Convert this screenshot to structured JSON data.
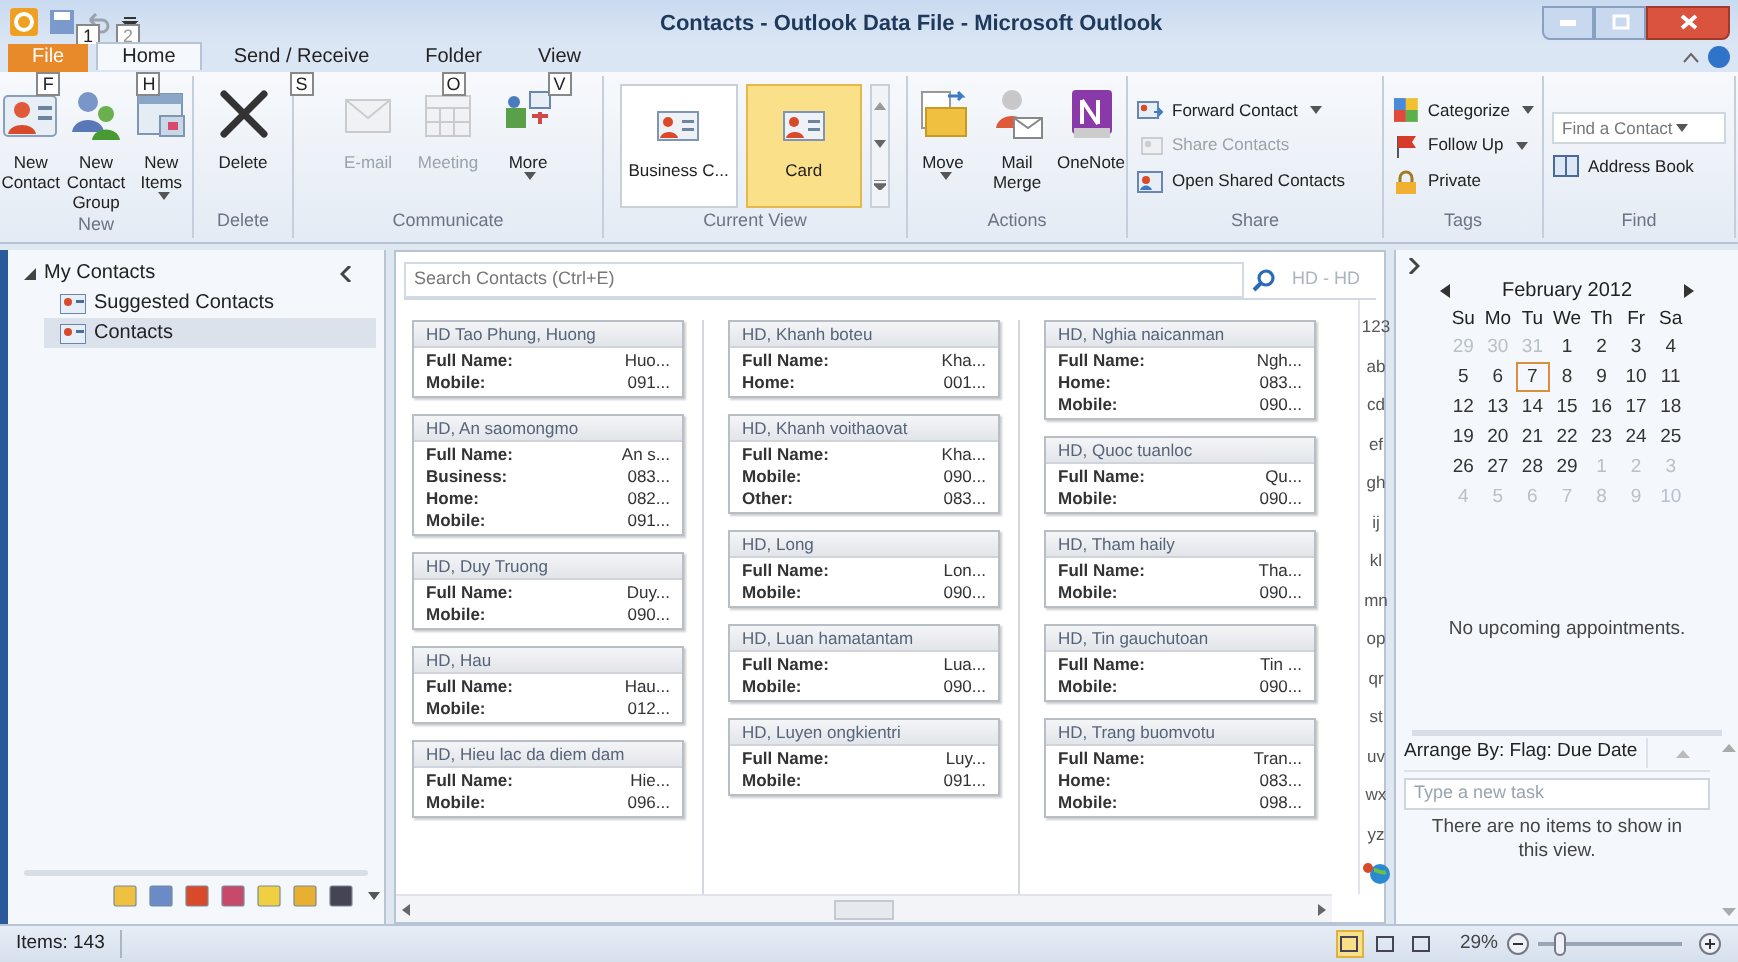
{
  "window": {
    "title": "Contacts - Outlook Data File - Microsoft Outlook"
  },
  "quick_access_keytips": [
    "1",
    "2"
  ],
  "tabs": [
    {
      "label": "File",
      "selected": false,
      "kind": "file",
      "keytip": "F"
    },
    {
      "label": "Home",
      "selected": true,
      "kind": "tab",
      "keytip": "H"
    },
    {
      "label": "Send / Receive",
      "selected": false,
      "kind": "tab",
      "keytip": "S"
    },
    {
      "label": "Folder",
      "selected": false,
      "kind": "tab",
      "keytip": "O"
    },
    {
      "label": "View",
      "selected": false,
      "kind": "tab",
      "keytip": "V"
    }
  ],
  "ribbon": [
    {
      "label": "New",
      "items": [
        {
          "label": "New Contact",
          "kind": "large",
          "disabled": false
        },
        {
          "label": "New Contact Group",
          "kind": "large",
          "disabled": false
        },
        {
          "label": "New Items",
          "kind": "large",
          "disabled": false,
          "dropdown": true
        }
      ]
    },
    {
      "label": "Delete",
      "items": [
        {
          "label": "Delete",
          "kind": "large",
          "disabled": false
        }
      ]
    },
    {
      "label": "Communicate",
      "items": [
        {
          "label": "E-mail",
          "kind": "large",
          "disabled": true
        },
        {
          "label": "Meeting",
          "kind": "large",
          "disabled": true
        },
        {
          "label": "More",
          "kind": "large",
          "disabled": false,
          "dropdown": true
        }
      ]
    },
    {
      "label": "Current View",
      "items": [
        {
          "label": "Business C...",
          "kind": "gallery",
          "selected": false
        },
        {
          "label": "Card",
          "kind": "gallery",
          "selected": true
        }
      ]
    },
    {
      "label": "Actions",
      "items": [
        {
          "label": "Move",
          "kind": "large",
          "disabled": false,
          "dropdown": true
        },
        {
          "label": "Mail Merge",
          "kind": "large",
          "disabled": false
        },
        {
          "label": "OneNote",
          "kind": "large",
          "disabled": false
        }
      ]
    },
    {
      "label": "Share",
      "items": [
        {
          "label": "Forward Contact",
          "kind": "small",
          "disabled": false,
          "dropdown": true
        },
        {
          "label": "Share Contacts",
          "kind": "small",
          "disabled": true
        },
        {
          "label": "Open Shared Contacts",
          "kind": "small",
          "disabled": false
        }
      ]
    },
    {
      "label": "Tags",
      "items": [
        {
          "label": "Categorize",
          "kind": "small",
          "disabled": false,
          "dropdown": true
        },
        {
          "label": "Follow Up",
          "kind": "small",
          "disabled": false,
          "dropdown": true
        },
        {
          "label": "Private",
          "kind": "small",
          "disabled": false
        }
      ]
    },
    {
      "label": "Find",
      "items": [
        {
          "label": "Find a Contact",
          "kind": "search",
          "disabled": false,
          "dropdown": true
        },
        {
          "label": "Address Book",
          "kind": "small",
          "disabled": false
        }
      ]
    }
  ],
  "navigation": {
    "label": "My Contacts",
    "expanded": true,
    "children": [
      {
        "label": "Suggested Contacts",
        "selected": false
      },
      {
        "label": "Contacts",
        "selected": true
      }
    ]
  },
  "search": {
    "placeholder": "Search Contacts (Ctrl+E)",
    "scope": "HD - HD"
  },
  "card_columns": [
    [
      {
        "title": "HD Tao Phung, Huong",
        "fields": [
          {
            "label": "Full Name:",
            "value": "Huo..."
          },
          {
            "label": "Mobile:",
            "value": "091..."
          }
        ]
      },
      {
        "title": "HD, An saomongmo",
        "fields": [
          {
            "label": "Full Name:",
            "value": "An s..."
          },
          {
            "label": "Business:",
            "value": "083..."
          },
          {
            "label": "Home:",
            "value": "082..."
          },
          {
            "label": "Mobile:",
            "value": "091..."
          }
        ]
      },
      {
        "title": "HD, Duy Truong",
        "fields": [
          {
            "label": "Full Name:",
            "value": "Duy..."
          },
          {
            "label": "Mobile:",
            "value": "090..."
          }
        ]
      },
      {
        "title": "HD, Hau",
        "fields": [
          {
            "label": "Full Name:",
            "value": "Hau..."
          },
          {
            "label": "Mobile:",
            "value": "012..."
          }
        ]
      },
      {
        "title": "HD, Hieu lac da diem dam",
        "fields": [
          {
            "label": "Full Name:",
            "value": "Hie..."
          },
          {
            "label": "Mobile:",
            "value": "096..."
          }
        ]
      }
    ],
    [
      {
        "title": "HD, Khanh boteu",
        "fields": [
          {
            "label": "Full Name:",
            "value": "Kha..."
          },
          {
            "label": "Home:",
            "value": "001..."
          }
        ]
      },
      {
        "title": "HD, Khanh voithaovat",
        "fields": [
          {
            "label": "Full Name:",
            "value": "Kha..."
          },
          {
            "label": "Mobile:",
            "value": "090..."
          },
          {
            "label": "Other:",
            "value": "083..."
          }
        ]
      },
      {
        "title": "HD, Long",
        "fields": [
          {
            "label": "Full Name:",
            "value": "Lon..."
          },
          {
            "label": "Mobile:",
            "value": "090..."
          }
        ]
      },
      {
        "title": "HD, Luan hamatantam",
        "fields": [
          {
            "label": "Full Name:",
            "value": "Lua..."
          },
          {
            "label": "Mobile:",
            "value": "090..."
          }
        ]
      },
      {
        "title": "HD, Luyen ongkientri",
        "fields": [
          {
            "label": "Full Name:",
            "value": "Luy..."
          },
          {
            "label": "Mobile:",
            "value": "091..."
          }
        ]
      }
    ],
    [
      {
        "title": "HD, Nghia naicanman",
        "fields": [
          {
            "label": "Full Name:",
            "value": "Ngh..."
          },
          {
            "label": "Home:",
            "value": "083..."
          },
          {
            "label": "Mobile:",
            "value": "090..."
          }
        ]
      },
      {
        "title": "HD, Quoc tuanloc",
        "fields": [
          {
            "label": "Full Name:",
            "value": "Qu..."
          },
          {
            "label": "Mobile:",
            "value": "090..."
          }
        ]
      },
      {
        "title": "HD, Tham haily",
        "fields": [
          {
            "label": "Full Name:",
            "value": "Tha..."
          },
          {
            "label": "Mobile:",
            "value": "090..."
          }
        ]
      },
      {
        "title": "HD, Tin gauchutoan",
        "fields": [
          {
            "label": "Full Name:",
            "value": "Tin ..."
          },
          {
            "label": "Mobile:",
            "value": "090..."
          }
        ]
      },
      {
        "title": "HD, Trang buomvotu",
        "fields": [
          {
            "label": "Full Name:",
            "value": "Tran..."
          },
          {
            "label": "Home:",
            "value": "083..."
          },
          {
            "label": "Mobile:",
            "value": "098..."
          }
        ]
      }
    ]
  ],
  "index": [
    "123",
    "ab",
    "cd",
    "ef",
    "gh",
    "ij",
    "kl",
    "mn",
    "op",
    "qr",
    "st",
    "uv",
    "wx",
    "yz"
  ],
  "calendar": {
    "month": "February 2012",
    "weekdays": [
      "Su",
      "Mo",
      "Tu",
      "We",
      "Th",
      "Fr",
      "Sa"
    ],
    "weeks": [
      [
        {
          "day": "29",
          "other_month": true,
          "selected": false
        },
        {
          "day": "30",
          "other_month": true,
          "selected": false
        },
        {
          "day": "31",
          "other_month": true,
          "selected": false
        },
        {
          "day": "1",
          "other_month": false,
          "selected": false
        },
        {
          "day": "2",
          "other_month": false,
          "selected": false
        },
        {
          "day": "3",
          "other_month": false,
          "selected": false
        },
        {
          "day": "4",
          "other_month": false,
          "selected": false
        }
      ],
      [
        {
          "day": "5",
          "other_month": false,
          "selected": false
        },
        {
          "day": "6",
          "other_month": false,
          "selected": false
        },
        {
          "day": "7",
          "other_month": false,
          "selected": true
        },
        {
          "day": "8",
          "other_month": false,
          "selected": false
        },
        {
          "day": "9",
          "other_month": false,
          "selected": false
        },
        {
          "day": "10",
          "other_month": false,
          "selected": false
        },
        {
          "day": "11",
          "other_month": false,
          "selected": false
        }
      ],
      [
        {
          "day": "12",
          "other_month": false,
          "selected": false
        },
        {
          "day": "13",
          "other_month": false,
          "selected": false
        },
        {
          "day": "14",
          "other_month": false,
          "selected": false
        },
        {
          "day": "15",
          "other_month": false,
          "selected": false
        },
        {
          "day": "16",
          "other_month": false,
          "selected": false
        },
        {
          "day": "17",
          "other_month": false,
          "selected": false
        },
        {
          "day": "18",
          "other_month": false,
          "selected": false
        }
      ],
      [
        {
          "day": "19",
          "other_month": false,
          "selected": false
        },
        {
          "day": "20",
          "other_month": false,
          "selected": false
        },
        {
          "day": "21",
          "other_month": false,
          "selected": false
        },
        {
          "day": "22",
          "other_month": false,
          "selected": false
        },
        {
          "day": "23",
          "other_month": false,
          "selected": false
        },
        {
          "day": "24",
          "other_month": false,
          "selected": false
        },
        {
          "day": "25",
          "other_month": false,
          "selected": false
        }
      ],
      [
        {
          "day": "26",
          "other_month": false,
          "selected": false
        },
        {
          "day": "27",
          "other_month": false,
          "selected": false
        },
        {
          "day": "28",
          "other_month": false,
          "selected": false
        },
        {
          "day": "29",
          "other_month": false,
          "selected": false
        },
        {
          "day": "1",
          "other_month": true,
          "selected": false
        },
        {
          "day": "2",
          "other_month": true,
          "selected": false
        },
        {
          "day": "3",
          "other_month": true,
          "selected": false
        }
      ],
      [
        {
          "day": "4",
          "other_month": true,
          "selected": false
        },
        {
          "day": "5",
          "other_month": true,
          "selected": false
        },
        {
          "day": "6",
          "other_month": true,
          "selected": false
        },
        {
          "day": "7",
          "other_month": true,
          "selected": false
        },
        {
          "day": "8",
          "other_month": true,
          "selected": false
        },
        {
          "day": "9",
          "other_month": true,
          "selected": false
        },
        {
          "day": "10",
          "other_month": true,
          "selected": false
        }
      ]
    ]
  },
  "appointments": {
    "message": "No upcoming appointments."
  },
  "tasks": {
    "arrange_by": "Arrange By: Flag: Due Date",
    "placeholder": "Type a new task",
    "message": "There are no items to show in this view."
  },
  "status_bar": {
    "items": "Items: 143",
    "views": [
      {
        "selected": true
      },
      {
        "selected": false
      },
      {
        "selected": false
      }
    ],
    "zoom": "29%",
    "zoom_slider": {
      "level": 0.15
    }
  }
}
